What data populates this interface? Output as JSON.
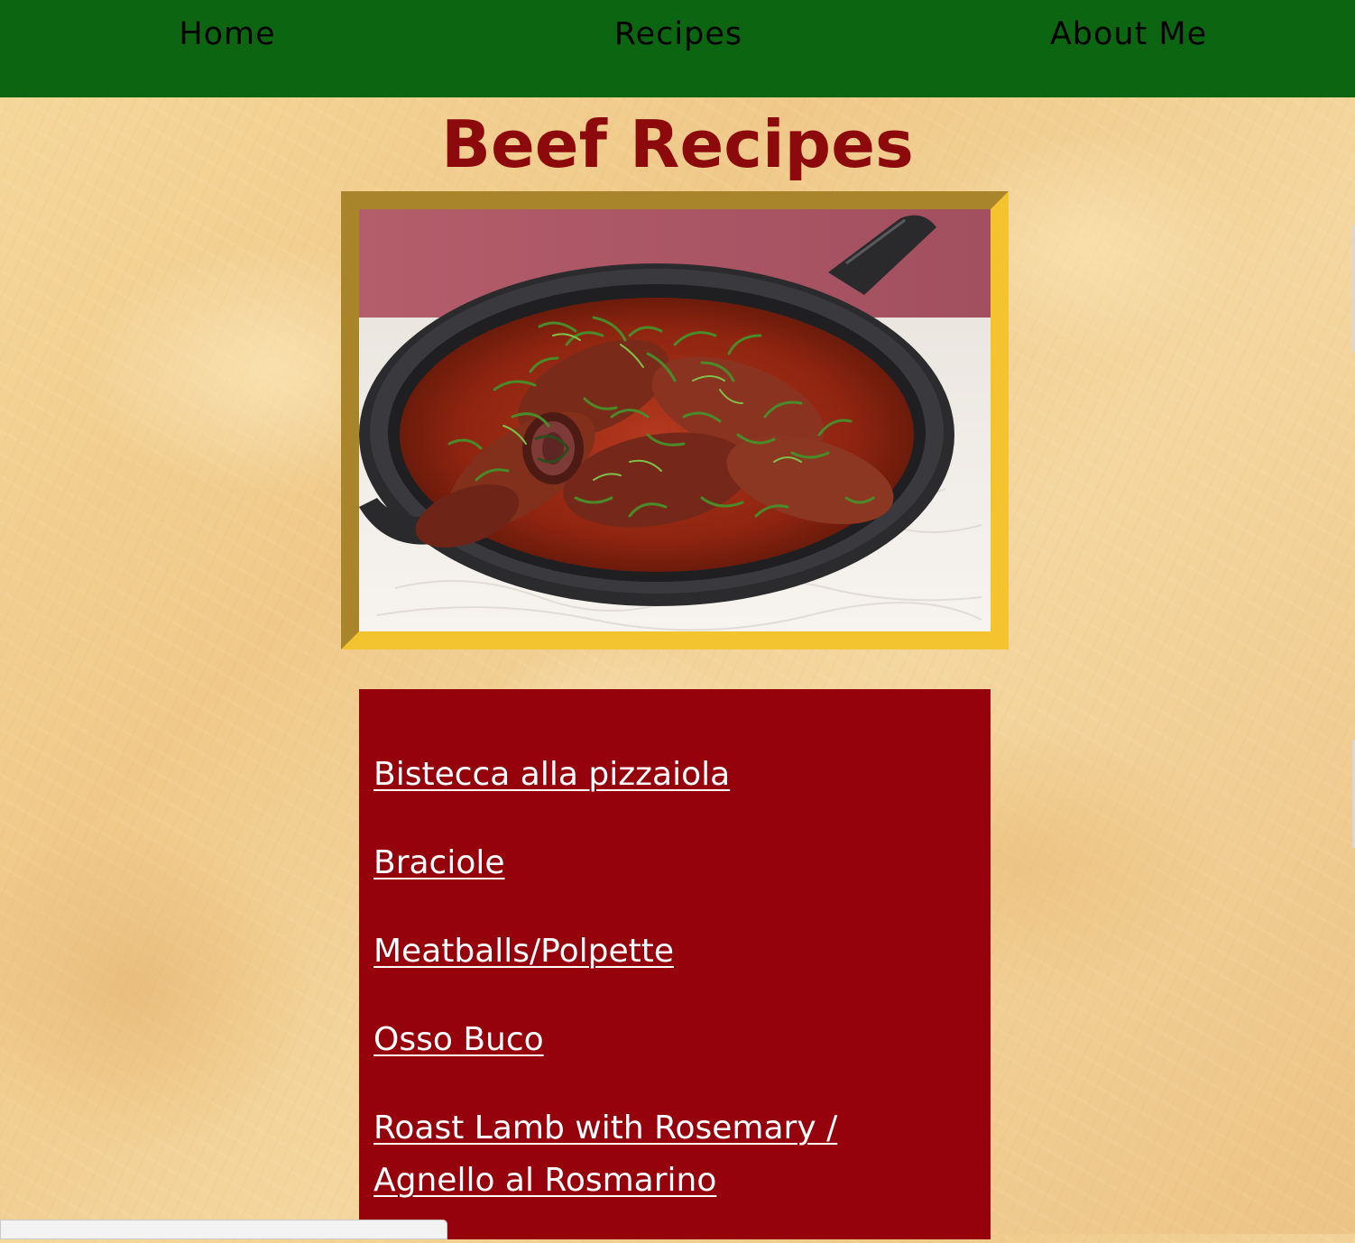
{
  "nav": {
    "items": [
      {
        "label": "Home"
      },
      {
        "label": "Recipes"
      },
      {
        "label": "About Me"
      }
    ]
  },
  "page": {
    "title": "Beef Recipes"
  },
  "hero_image": {
    "icon": "braciole-pan-photo"
  },
  "recipes": {
    "items": [
      {
        "label": "Bistecca alla pizzaiola"
      },
      {
        "label": "Braciole"
      },
      {
        "label": "Meatballs/Polpette"
      },
      {
        "label": "Osso Buco"
      },
      {
        "label": "Roast Lamb with Rosemary / Agnello al Rosmarino"
      }
    ]
  },
  "colors": {
    "nav_bg": "#0c6510",
    "title": "#8c0a0c",
    "recipe_box_bg": "#95020b",
    "frame_dark": "#a8842a",
    "frame_light": "#f4c430"
  }
}
